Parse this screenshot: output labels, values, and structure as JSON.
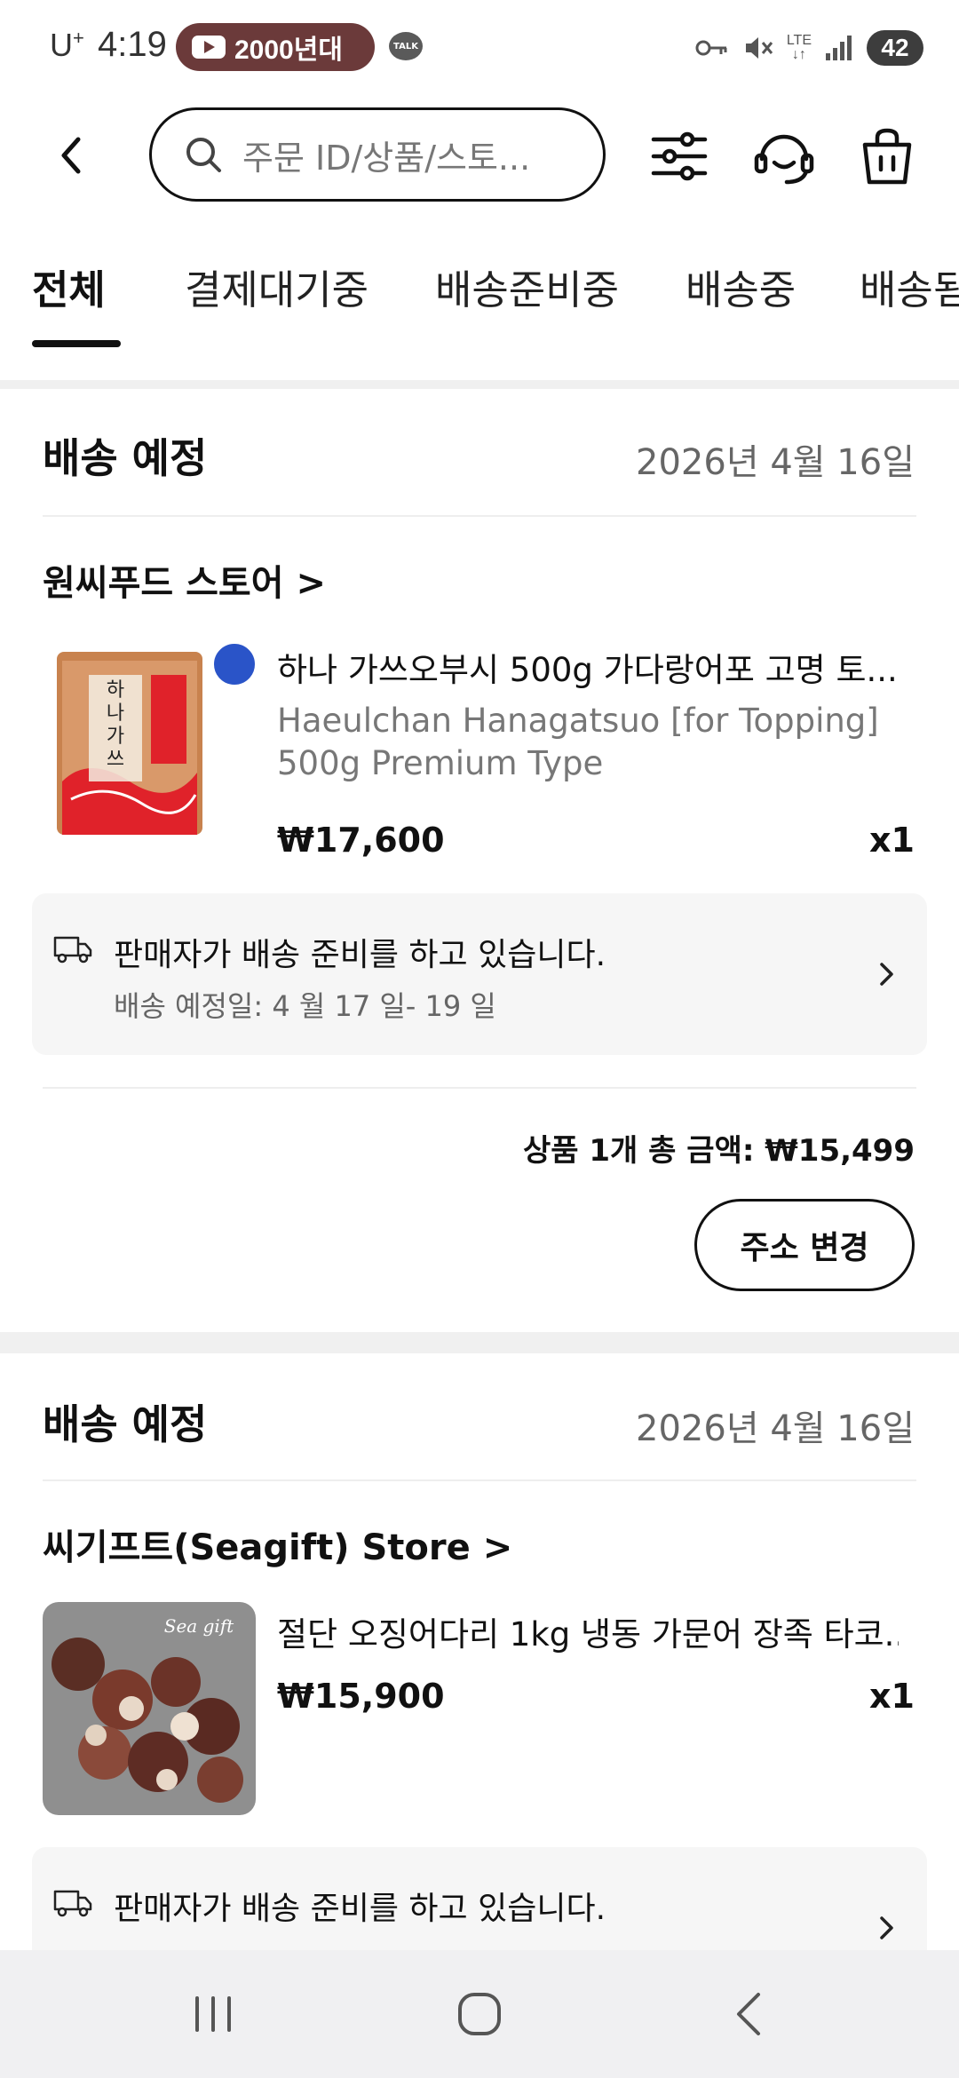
{
  "status_bar": {
    "carrier": "U",
    "carrier_sup": "+",
    "time": "4:19",
    "youtube_pill_text": "2000년대",
    "talk_badge": "TALK",
    "network": "LTE",
    "battery": "42",
    "icons": [
      "key-icon",
      "mute-icon",
      "lte-icon",
      "signal-icon",
      "battery-icon"
    ]
  },
  "header": {
    "search_placeholder": "주문 ID/상품/스토...",
    "icons": [
      "back-icon",
      "search-icon",
      "filter-icon",
      "support-icon",
      "cart-icon"
    ]
  },
  "tabs": [
    {
      "label": "전체",
      "active": true
    },
    {
      "label": "결제대기중",
      "active": false
    },
    {
      "label": "배송준비중",
      "active": false
    },
    {
      "label": "배송중",
      "active": false
    },
    {
      "label": "배송됨",
      "active": false
    }
  ],
  "orders": [
    {
      "title": "배송 예정",
      "date": "2026년 4월 16일",
      "store": "원씨푸드 스토어",
      "product_name": "하나 가쓰오부시 500g 가다랑어포 고명 토...",
      "product_sub": "Haeulchan Hanagatsuo [for Topping] 500g Premium Type",
      "price": "₩17,600",
      "qty": "x1",
      "shipping_status": "판매자가 배송 준비를 하고 있습니다.",
      "shipping_eta": "배송 예정일: 4 월 17 일- 19 일",
      "total": "상품 1개 총 금액: ₩15,499",
      "button": "주소 변경",
      "package_text": "하나가쓰오"
    },
    {
      "title": "배송 예정",
      "date": "2026년 4월 16일",
      "store": "씨기프트(Seagift) Store",
      "product_name": "절단 오징어다리 1kg 냉동 가문어 장족 타코...",
      "price": "₩15,900",
      "qty": "x1",
      "shipping_status": "판매자가 배송 준비를 하고 있습니다.",
      "image_watermark": "Sea gift"
    }
  ],
  "nav": [
    "recents-button",
    "home-button",
    "back-button"
  ]
}
